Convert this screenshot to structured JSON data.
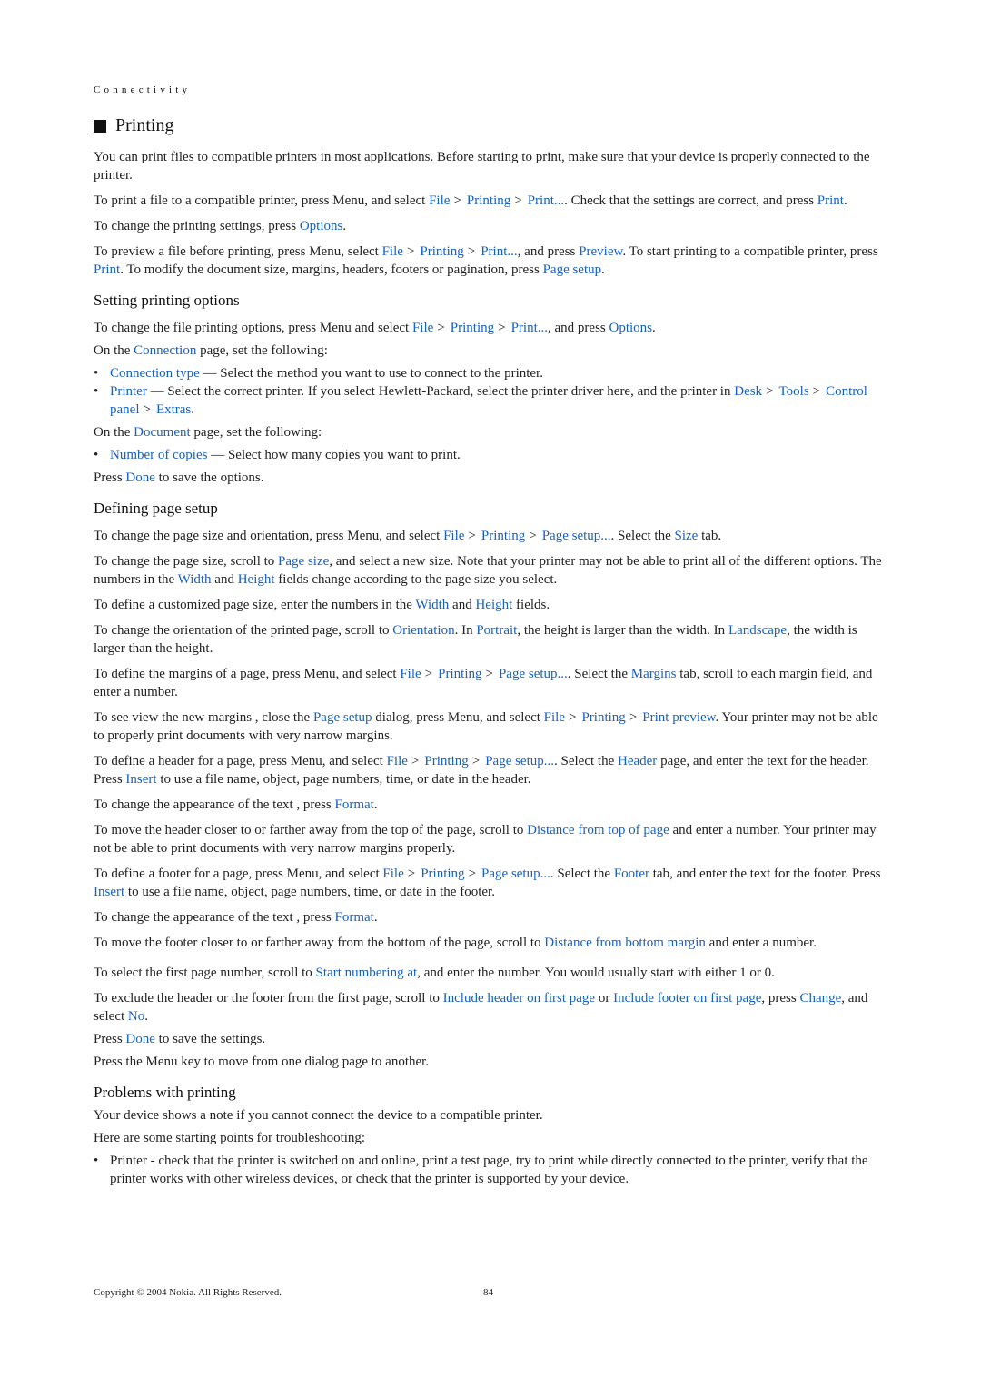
{
  "header": {
    "section": "Connectivity",
    "title": "Printing"
  },
  "intro": {
    "p1": "You can print files to compatible printers in most applications. Before starting to print, make sure that your device is properly connected to the printer.",
    "p2": {
      "t1": "To print a file to a compatible printer, press Menu, and select ",
      "l1": "File",
      "l2": "Printing",
      "l3": "Print...",
      "t2": ". Check that the settings are correct, and press ",
      "l4": "Print",
      "t3": "."
    },
    "p3": {
      "t1": "To change the printing settings, press ",
      "l1": "Options",
      "t2": "."
    },
    "p4": {
      "t1": "To preview a file before printing, press Menu, select ",
      "l1": "File",
      "l2": "Printing",
      "l3": "Print...",
      "t2": ", and press ",
      "l4": "Preview",
      "t3": ". To start printing to a compatible printer, press ",
      "l5": "Print",
      "t4": ". To modify the document size, margins, headers, footers or pagination, press ",
      "l6": "Page setup",
      "t5": "."
    }
  },
  "options": {
    "heading": "Setting printing options",
    "p1": {
      "t1": "To change the file printing options, press Menu and select ",
      "l1": "File",
      "l2": "Printing",
      "l3": "Print...",
      "t2": ", and press ",
      "l4": "Options",
      "t3": "."
    },
    "p2": {
      "t1": "On the ",
      "l1": "Connection",
      "t2": " page, set the following:"
    },
    "b1": {
      "l1": "Connection type",
      "t1": " — Select the method you want to use to connect to the printer."
    },
    "b2": {
      "l1": "Printer",
      "t1": " — Select the correct printer. If you select Hewlett-Packard, select the printer driver here, and the printer in ",
      "l2": "Desk",
      "l3": "Tools",
      "l4": "Control panel",
      "l5": "Extras",
      "t2": "."
    },
    "p3": {
      "t1": "On the ",
      "l1": "Document",
      "t2": " page, set the following:"
    },
    "b3": {
      "l1": "Number of copies",
      "t1": " — Select how many copies you want to print."
    },
    "p4": {
      "t1": "Press ",
      "l1": "Done",
      "t2": " to save the options."
    }
  },
  "setup": {
    "heading": "Defining page setup",
    "p1": {
      "t1": "To change the page size and orientation, press Menu, and select ",
      "l1": "File",
      "l2": "Printing",
      "l3": "Page setup...",
      "t2": ". Select the ",
      "l4": "Size",
      "t3": " tab."
    },
    "p2": {
      "t1": "To change the page size, scroll to ",
      "l1": "Page size",
      "t2": ", and select a new size. Note that your printer may not be able to print all of the different options. The numbers in the ",
      "l2": "Width",
      "t3": " and ",
      "l3": "Height",
      "t4": " fields change according to the page size you select."
    },
    "p3": {
      "t1": "To define a customized page size, enter the numbers in the ",
      "l1": "Width",
      "t2": " and ",
      "l2": "Height",
      "t3": " fields."
    },
    "p4": {
      "t1": "To change the orientation of the printed page, scroll to ",
      "l1": "Orientation",
      "t2": ". In ",
      "l2": "Portrait",
      "t3": ", the height is larger than the width. In ",
      "l3": "Landscape",
      "t4": ", the width is larger than the height."
    },
    "p5": {
      "t1": "To define the margins of a page, press Menu, and select ",
      "l1": "File",
      "l2": "Printing",
      "l3": "Page setup...",
      "t2": ". Select the ",
      "l4": "Margins",
      "t3": " tab, scroll to each margin field, and enter a number."
    },
    "p6": {
      "t1": "To see view the new margins , close the ",
      "l1": "Page setup",
      "t2": " dialog, press Menu, and select ",
      "l2": "File",
      "l3": "Printing",
      "l4": "Print preview",
      "t3": ". Your printer may not be able to properly print documents with very narrow margins."
    },
    "p7": {
      "t1": "To define a header for a page, press Menu, and select ",
      "l1": "File",
      "l2": "Printing",
      "l3": "Page setup...",
      "t2": ". Select the ",
      "l4": "Header",
      "t3": " page, and enter the text for the header. Press ",
      "l5": "Insert",
      "t4": " to use a file name, object, page numbers, time, or date in the header."
    },
    "p8": {
      "t1": "To change the appearance of the text , press ",
      "l1": "Format",
      "t2": "."
    },
    "p9": {
      "t1": "To move the header closer to or farther away from the top of the page, scroll to ",
      "l1": "Distance from top of page",
      "t2": " and enter a number. Your printer may not be able to print documents with very narrow margins properly."
    },
    "p10": {
      "t1": "To define a footer for a page, press Menu, and select ",
      "l1": "File",
      "l2": "Printing",
      "l3": "Page setup...",
      "t2": ". Select the ",
      "l4": "Footer",
      "t3": " tab, and enter the text for the footer. Press ",
      "l5": "Insert",
      "t4": " to use a file name, object, page numbers, time, or date in the footer."
    },
    "p11": {
      "t1": "To change the appearance of the text , press ",
      "l1": "Format",
      "t2": "."
    },
    "p12": {
      "t1": "To move the footer closer to or farther away from the bottom of the page, scroll to ",
      "l1": "Distance from bottom margin",
      "t2": " and enter a number."
    },
    "p13": {
      "t1": "To select the first page number, scroll to ",
      "l1": "Start numbering at",
      "t2": ", and enter the number. You would usually start with either 1 or 0."
    },
    "p14": {
      "t1": "To exclude the header or the footer from the first page, scroll to ",
      "l1": "Include header on first page",
      "t2": " or ",
      "l2": "Include footer on first page",
      "t3": ", press ",
      "l3": "Change",
      "t4": ", and select ",
      "l4": "No",
      "t5": "."
    },
    "p15": {
      "t1": "Press ",
      "l1": "Done",
      "t2": " to save the settings."
    },
    "p16": "Press the Menu key to move from one dialog page to another."
  },
  "problems": {
    "heading": "Problems with printing",
    "p1": "Your device shows a note if you cannot connect the device to a compatible printer.",
    "p2": "Here are some starting points for troubleshooting:",
    "b1": "Printer - check that the printer is switched on and online, print a test page, try to print while directly connected to the printer, verify that the printer works with other wireless devices, or check that the printer is supported by your device."
  },
  "separator": ">",
  "footer": {
    "copyright": "Copyright © 2004 Nokia. All Rights Reserved.",
    "page_number": "84"
  }
}
